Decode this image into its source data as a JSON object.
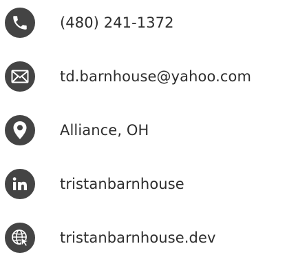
{
  "contacts": {
    "phone": {
      "icon": "phone-icon",
      "text": "(480) 241-1372"
    },
    "email": {
      "icon": "envelope-icon",
      "text": "td.barnhouse@yahoo.com"
    },
    "location": {
      "icon": "map-pin-icon",
      "text": "Alliance, OH"
    },
    "linkedin": {
      "icon": "linkedin-icon",
      "text": "tristanbarnhouse"
    },
    "website": {
      "icon": "globe-cursor-icon",
      "text": "tristanbarnhouse.dev"
    }
  },
  "colors": {
    "icon_background": "#444444",
    "icon_foreground": "#ffffff",
    "text": "#2d2d2d"
  }
}
